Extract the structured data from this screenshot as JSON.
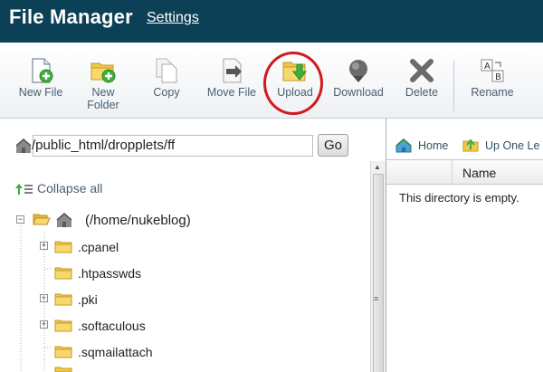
{
  "header": {
    "title": "File Manager",
    "settings_link": "Settings"
  },
  "toolbar": {
    "new_file": {
      "label": "New File",
      "icon": "new-file-icon"
    },
    "new_folder": {
      "label_line1": "New",
      "label_line2": "Folder",
      "icon": "new-folder-icon"
    },
    "copy": {
      "label": "Copy",
      "icon": "copy-icon"
    },
    "move_file": {
      "label": "Move File",
      "icon": "move-file-icon"
    },
    "upload": {
      "label": "Upload",
      "icon": "upload-icon"
    },
    "download": {
      "label": "Download",
      "icon": "download-icon"
    },
    "delete": {
      "label": "Delete",
      "icon": "delete-icon"
    },
    "rename": {
      "label": "Rename",
      "icon": "rename-icon"
    }
  },
  "path_bar": {
    "value": "/public_html/dropplets/ff",
    "go_label": "Go"
  },
  "tree": {
    "collapse_all": "Collapse all",
    "root_label": "(/home/nukeblog)",
    "items": [
      {
        "label": ".cpanel",
        "expandable": true
      },
      {
        "label": ".htpasswds",
        "expandable": false
      },
      {
        "label": ".pki",
        "expandable": true
      },
      {
        "label": ".softaculous",
        "expandable": true
      },
      {
        "label": ".sqmailattach",
        "expandable": false
      }
    ]
  },
  "right_pane": {
    "home_label": "Home",
    "up_label": "Up One Le",
    "column_name": "Name",
    "empty_message": "This directory is empty."
  },
  "colors": {
    "header_bg": "#0c4057",
    "highlight_ring": "#d3181e",
    "folder_yellow": "#f2c84b"
  }
}
